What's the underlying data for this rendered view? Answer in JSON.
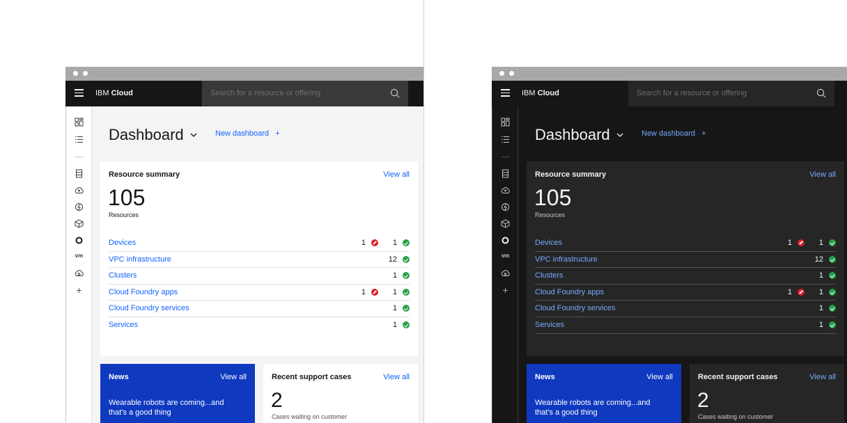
{
  "brand": {
    "prefix": "IBM",
    "name": "Cloud"
  },
  "search": {
    "placeholder": "Search for a resource or offering"
  },
  "dashboard": {
    "title": "Dashboard",
    "new_label": "New dashboard",
    "new_icon": "+"
  },
  "resource_summary": {
    "title": "Resource summary",
    "view_all": "View all",
    "count": "105",
    "count_label": "Resources",
    "rows": [
      {
        "name": "Devices",
        "errors": "1",
        "ok": "1"
      },
      {
        "name": "VPC infrastructure",
        "errors": "",
        "ok": "12"
      },
      {
        "name": "Clusters",
        "errors": "",
        "ok": "1"
      },
      {
        "name": "Cloud Foundry apps",
        "errors": "1",
        "ok": "1"
      },
      {
        "name": "Cloud Foundry services",
        "errors": "",
        "ok": "1"
      },
      {
        "name": "Services",
        "errors": "",
        "ok": "1"
      }
    ]
  },
  "news": {
    "title": "News",
    "view_all": "View all",
    "headline": "Wearable robots are coming...and that's a good thing"
  },
  "support": {
    "title": "Recent support cases",
    "view_all": "View all",
    "count": "2",
    "count_label": "Cases waiting on customer"
  },
  "sidenav": {
    "vm_label": "vm",
    "add_label": "+"
  },
  "icons": [
    "hamburger-icon",
    "search-icon",
    "dashboard-icon",
    "list-icon",
    "storage-icon",
    "cloud-upload-icon",
    "functions-icon",
    "box-icon",
    "openshift-icon",
    "vmware-icon",
    "cloud-services-icon",
    "add-icon",
    "chevron-down-icon",
    "error-icon",
    "success-icon"
  ],
  "colors": {
    "link": "#0f62fe",
    "link_dark": "#78a9ff",
    "error": "#da1e28",
    "success": "#24a148",
    "news_bg": "#0f3abf",
    "shell": "#161616"
  }
}
